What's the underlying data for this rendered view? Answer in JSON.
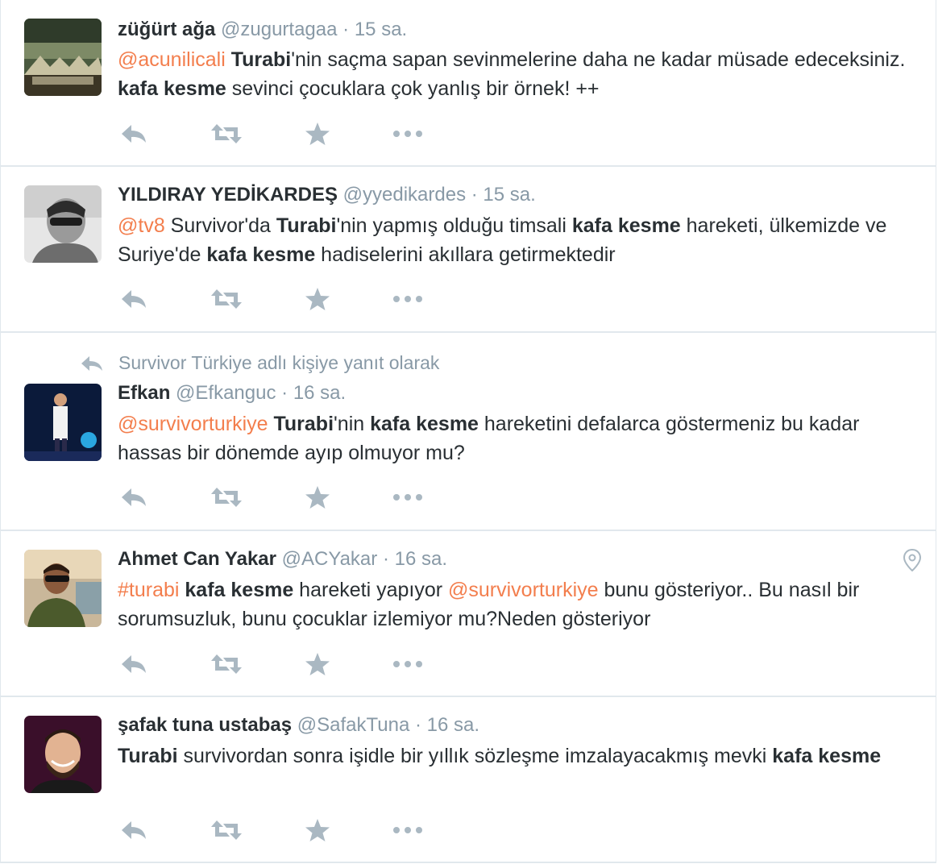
{
  "tweets": [
    {
      "name": "züğürt ağa",
      "handle": "@zugurtagaa",
      "separator": "·",
      "time": "15 sa.",
      "text_parts": [
        {
          "t": "mention",
          "v": "@acunilicali"
        },
        {
          "t": "plain",
          "v": " "
        },
        {
          "t": "kw",
          "v": "Turabi"
        },
        {
          "t": "plain",
          "v": "'nin saçma sapan sevinmelerine daha ne kadar müsade edeceksiniz. "
        },
        {
          "t": "kw",
          "v": "kafa kesme"
        },
        {
          "t": "plain",
          "v": " sevinci çocuklara çok yanlış bir örnek! ++"
        }
      ]
    },
    {
      "name": "YILDIRAY YEDİKARDEŞ",
      "handle": "@yyedikardes",
      "separator": "·",
      "time": "15 sa.",
      "text_parts": [
        {
          "t": "mention",
          "v": "@tv8"
        },
        {
          "t": "plain",
          "v": " Survivor'da "
        },
        {
          "t": "kw",
          "v": "Turabi"
        },
        {
          "t": "plain",
          "v": "'nin yapmış olduğu timsali "
        },
        {
          "t": "kw",
          "v": "kafa kesme"
        },
        {
          "t": "plain",
          "v": " hareketi, ülkemizde ve Suriye'de "
        },
        {
          "t": "kw",
          "v": "kafa kesme"
        },
        {
          "t": "plain",
          "v": " hadiselerini akıllara getirmektedir"
        }
      ]
    },
    {
      "context": "Survivor Türkiye adlı kişiye yanıt olarak",
      "name": "Efkan",
      "handle": "@Efkanguc",
      "separator": "·",
      "time": "16 sa.",
      "text_parts": [
        {
          "t": "mention",
          "v": "@survivorturkiye"
        },
        {
          "t": "plain",
          "v": " "
        },
        {
          "t": "kw",
          "v": "Turabi"
        },
        {
          "t": "plain",
          "v": "'nin "
        },
        {
          "t": "kw",
          "v": "kafa kesme"
        },
        {
          "t": "plain",
          "v": " hareketini defalarca göstermeniz bu kadar hassas bir dönemde ayıp olmuyor mu?"
        }
      ]
    },
    {
      "name": "Ahmet Can Yakar",
      "handle": "@ACYakar",
      "separator": "·",
      "time": "16 sa.",
      "text_parts": [
        {
          "t": "hashtag",
          "v": "#turabi"
        },
        {
          "t": "plain",
          "v": " "
        },
        {
          "t": "kw",
          "v": "kafa kesme"
        },
        {
          "t": "plain",
          "v": " hareketi yapıyor "
        },
        {
          "t": "mention",
          "v": "@survivorturkiye"
        },
        {
          "t": "plain",
          "v": " bunu gösteriyor.. Bu nasıl bir sorumsuzluk, bunu çocuklar izlemiyor mu?Neden gösteriyor"
        }
      ]
    },
    {
      "name": "şafak tuna ustabaş",
      "handle": "@SafakTuna",
      "separator": "·",
      "time": "16 sa.",
      "text_parts": [
        {
          "t": "kw",
          "v": "Turabi"
        },
        {
          "t": "plain",
          "v": " survivordan sonra işidle bir yıllık sözleşme imzalayacakmış mevki "
        },
        {
          "t": "kw",
          "v": "kafa kesme"
        }
      ]
    }
  ],
  "icons": {
    "reply": "reply-icon",
    "retweet": "retweet-icon",
    "favorite": "star-icon",
    "more": "more-icon",
    "location": "location-pin-icon"
  },
  "colors": {
    "link": "#f37e4d",
    "muted": "#8899a6",
    "text": "#292f33",
    "icon": "#aab8c2",
    "border": "#e1e8ed"
  }
}
